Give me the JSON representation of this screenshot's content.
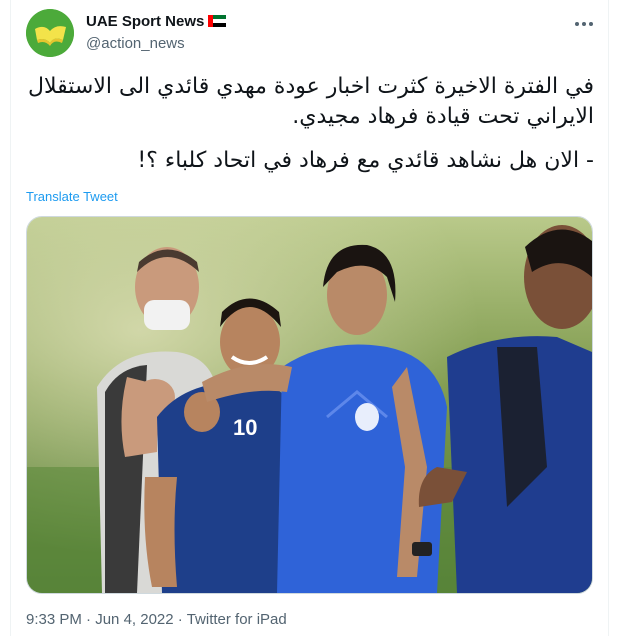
{
  "account": {
    "display_name": "UAE Sport News",
    "handle": "@action_news",
    "flag_icon": "uae-flag-icon"
  },
  "tweet": {
    "lines": [
      "في الفترة الاخيرة كثرت اخبار عودة مهدي قائدي الى الاستقلال الايراني تحت قيادة فرهاد مجيدي.",
      "- الان هل نشاهد قائدي مع فرهاد في اتحاد كلباء ؟!"
    ],
    "translate_label": "Translate Tweet"
  },
  "media": {
    "shirt_number": "10",
    "kit_color": "#2f63d8"
  },
  "footer": {
    "time": "9:33 PM",
    "separator": "·",
    "date": "Jun 4, 2022",
    "source": "Twitter for iPad"
  },
  "colors": {
    "link": "#1d9bf0",
    "secondary_text": "#536471",
    "avatar_bg": "#4caa3a"
  }
}
